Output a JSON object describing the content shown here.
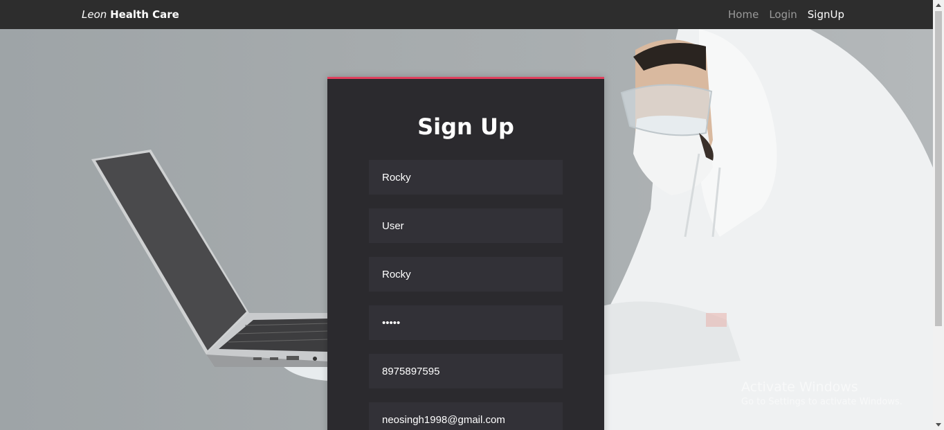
{
  "navbar": {
    "brand_italic": "Leon",
    "brand_bold": "Health Care",
    "links": [
      {
        "label": "Home"
      },
      {
        "label": "Login"
      },
      {
        "label": "SignUp"
      }
    ]
  },
  "form": {
    "title": "Sign Up",
    "fields": [
      {
        "value": "Rocky",
        "type": "text"
      },
      {
        "value": "User",
        "type": "text"
      },
      {
        "value": "Rocky",
        "type": "text"
      },
      {
        "value": "•••••",
        "type": "text"
      },
      {
        "value": "8975897595",
        "type": "text"
      },
      {
        "value": "neosingh1998@gmail.com",
        "type": "text"
      }
    ]
  },
  "watermark": {
    "title": "Activate Windows",
    "subtitle": "Go to Settings to activate Windows."
  },
  "colors": {
    "navbar_bg": "#2d2d2d",
    "card_bg": "#2b2a2e",
    "field_bg": "#323137",
    "accent": "#e0405e"
  }
}
